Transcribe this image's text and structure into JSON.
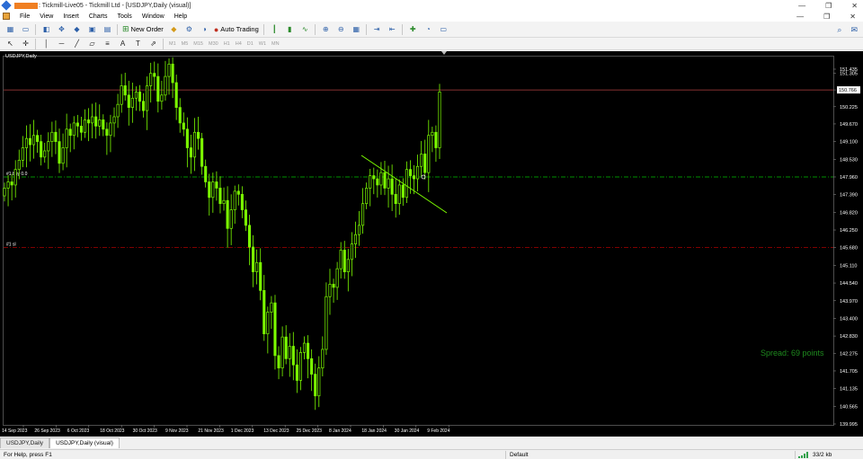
{
  "titlebar": {
    "title": ": Tickmill-Live05 - Tickmill Ltd - [USDJPY,Daily (visual)]",
    "minimize_glyph": "—",
    "restore_glyph": "❐",
    "close_glyph": "✕"
  },
  "menu": {
    "items": [
      "File",
      "View",
      "Insert",
      "Charts",
      "Tools",
      "Window",
      "Help"
    ],
    "minimize_glyph": "—",
    "restore_glyph": "❐",
    "close_glyph": "✕"
  },
  "toolbar": {
    "new_order_label": "New Order",
    "auto_trading_label": "Auto Trading",
    "timeframes": [
      "M1",
      "M5",
      "M15",
      "M30",
      "H1",
      "H4",
      "D1",
      "W1",
      "MN"
    ]
  },
  "chart": {
    "symbol_label": "USDJPY,Daily",
    "spread_text": "Spread: 69 points",
    "current_price": "150.766",
    "line_labels": [
      "#1 buy 0.0",
      "#1 sl"
    ],
    "colors": {
      "background": "#000000",
      "candle": "#7CFC00",
      "trade_line": "#00c000",
      "sl_line": "#cc0000",
      "bid_line": "#b04040",
      "trend_line": "#7CFC00",
      "axis_text": "#ffffff"
    }
  },
  "chart_data": {
    "type": "candlestick",
    "symbol": "USDJPY",
    "timeframe": "Daily",
    "y_ticks": [
      "151.435",
      "151.305",
      "150.766",
      "150.225",
      "149.670",
      "149.100",
      "148.530",
      "147.960",
      "147.390",
      "146.820",
      "146.250",
      "145.680",
      "145.110",
      "144.540",
      "143.970",
      "143.400",
      "142.830",
      "142.275",
      "141.705",
      "141.135",
      "140.565",
      "139.995"
    ],
    "x_ticks": [
      "14 Sep 2023",
      "26 Sep 2023",
      "6 Oct 2023",
      "18 Oct 2023",
      "30 Oct 2023",
      "9 Nov 2023",
      "21 Nov 2023",
      "1 Dec 2023",
      "13 Dec 2023",
      "25 Dec 2023",
      "8 Jan 2024",
      "18 Jan 2024",
      "30 Jan 2024",
      "9 Feb 2024"
    ],
    "ylim": [
      139.995,
      151.435
    ],
    "current_price": 150.766,
    "buy_level": 147.96,
    "sl_level": 145.68,
    "closes": [
      147.6,
      147.8,
      147.7,
      148.2,
      148.5,
      148.9,
      149.2,
      149.0,
      149.3,
      149.1,
      148.6,
      148.8,
      149.1,
      149.4,
      149.1,
      148.4,
      148.9,
      149.5,
      149.3,
      149.7,
      149.6,
      149.4,
      149.8,
      149.7,
      149.9,
      149.6,
      149.8,
      149.5,
      149.3,
      149.7,
      149.9,
      150.3,
      150.9,
      150.6,
      150.2,
      150.5,
      150.7,
      150.4,
      150.1,
      150.9,
      151.3,
      151.2,
      150.4,
      150.6,
      151.2,
      151.6,
      151.0,
      150.2,
      149.7,
      149.5,
      148.9,
      148.6,
      149.4,
      149.2,
      148.3,
      147.8,
      147.3,
      147.8,
      147.6,
      147.1,
      147.2,
      146.3,
      146.9,
      147.5,
      147.4,
      146.9,
      146.4,
      145.7,
      144.9,
      145.2,
      144.3,
      142.9,
      143.6,
      143.9,
      142.2,
      141.8,
      142.8,
      142.1,
      142.5,
      141.9,
      141.4,
      142.3,
      142.6,
      142.1,
      141.6,
      140.9,
      141.8,
      142.4,
      144.1,
      144.5,
      144.4,
      145.0,
      145.6,
      144.9,
      145.3,
      145.8,
      146.1,
      146.4,
      147.1,
      147.6,
      148.0,
      147.9,
      147.7,
      148.1,
      147.6,
      147.9,
      147.4,
      147.1,
      147.7,
      147.3,
      148.2,
      148.0,
      147.9,
      148.3,
      148.7,
      148.1,
      149.3,
      149.4,
      148.9,
      150.7
    ]
  },
  "tabs": [
    "USDJPY,Daily",
    "USDJPY,Daily (visual)"
  ],
  "status": {
    "help_text": "For Help, press F1",
    "profile": "Default",
    "connection": "33/2 kb"
  }
}
